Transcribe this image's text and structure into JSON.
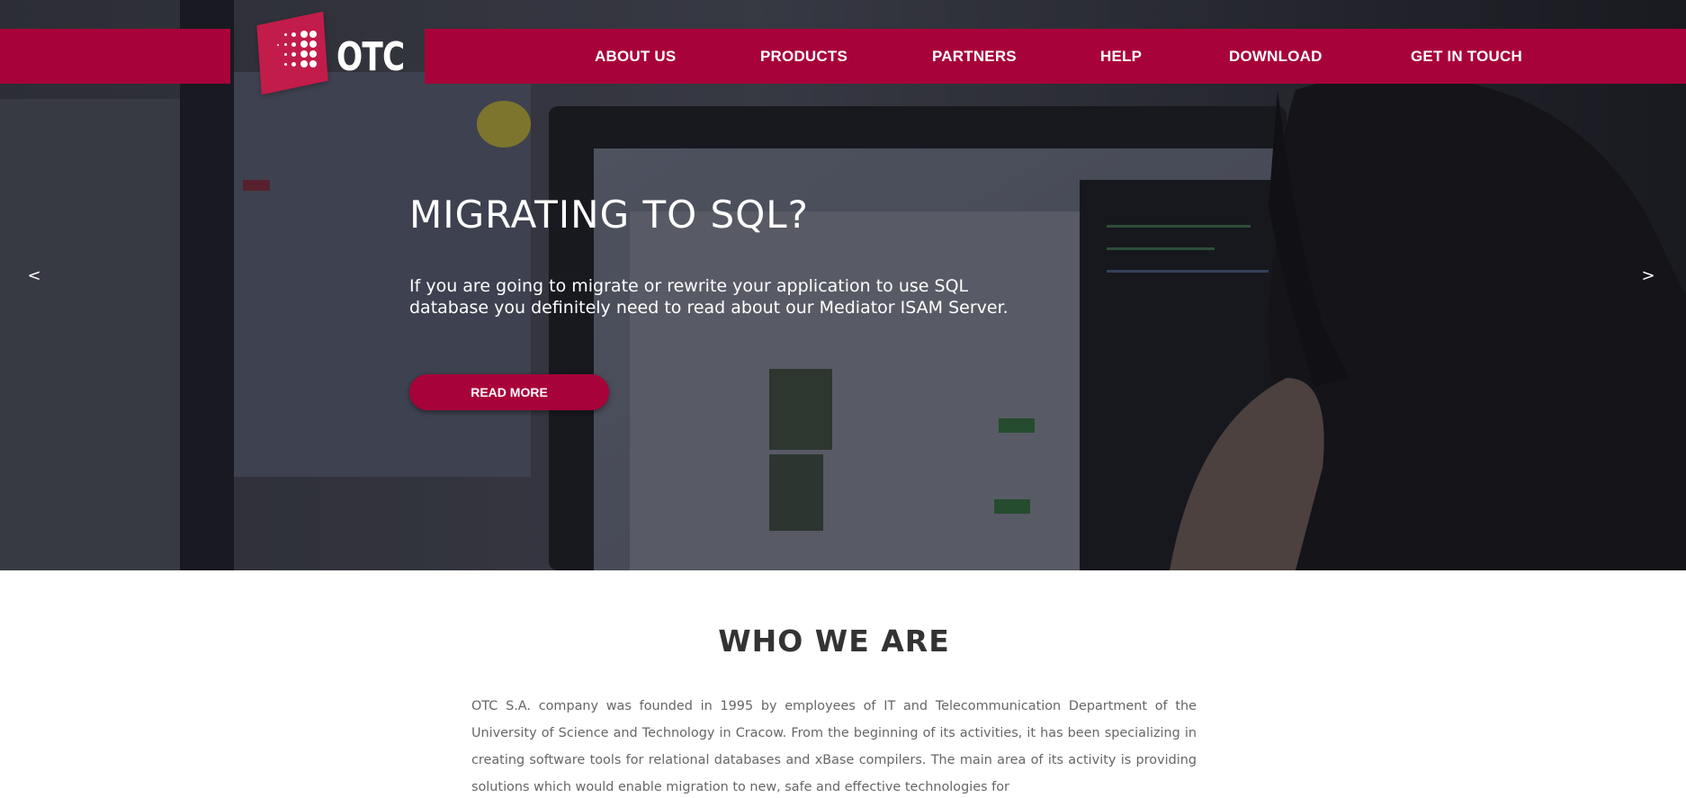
{
  "brand": {
    "name": "OTC",
    "accent": "#a8023a",
    "logo_color": "#c21c4a"
  },
  "nav": {
    "items": [
      {
        "label": "ABOUT US"
      },
      {
        "label": "PRODUCTS"
      },
      {
        "label": "PARTNERS"
      },
      {
        "label": "HELP"
      },
      {
        "label": "DOWNLOAD"
      },
      {
        "label": "GET IN TOUCH"
      }
    ]
  },
  "hero": {
    "title": "MIGRATING TO SQL?",
    "text": "If you are going to migrate or rewrite your application to use SQL database you definitely need to read about our Mediator ISAM Server.",
    "button_label": "READ MORE",
    "prev_label": "<",
    "next_label": ">"
  },
  "about": {
    "title": "WHO WE ARE",
    "body": "OTC S.A. company was founded in 1995 by employees of IT and Telecommunication Department of the University of Science and Technology in Cracow. From the beginning of its activities, it has been specializing in creating software tools for relational databases and xBase compilers. The main area of its activity is providing solutions which would enable migration to new, safe and effective technologies for"
  }
}
